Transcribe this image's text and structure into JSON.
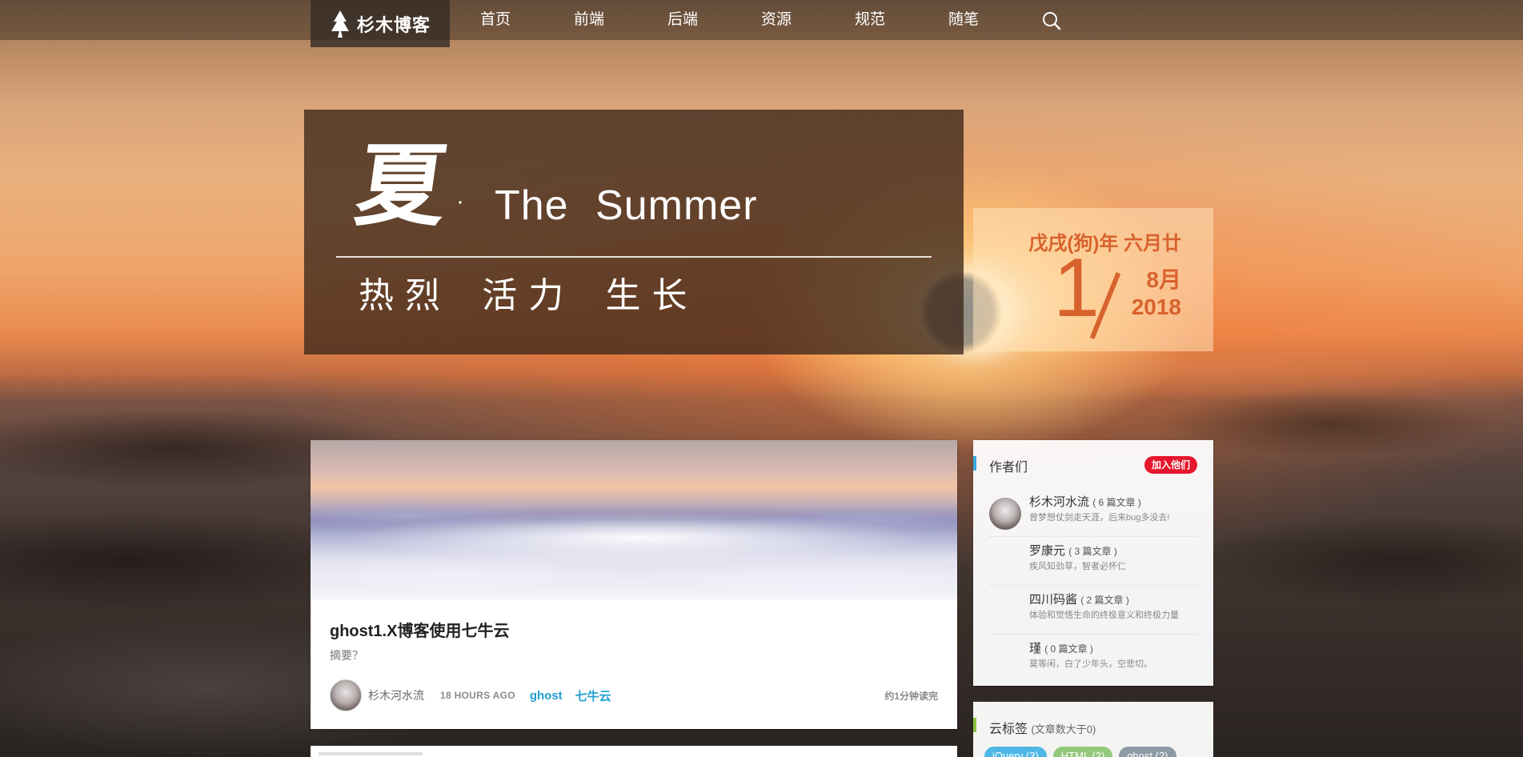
{
  "brand": {
    "name": "杉木博客"
  },
  "nav": {
    "items": [
      "首页",
      "前端",
      "后端",
      "资源",
      "规范",
      "随笔"
    ]
  },
  "hero": {
    "char": "夏",
    "dot": "·",
    "title": "The Summer",
    "subtitle": "热烈 活力 生长"
  },
  "date": {
    "lunar": "戊戌(狗)年 六月廿",
    "day": "1",
    "month": "8月",
    "year": "2018"
  },
  "post": {
    "title": "ghost1.X博客使用七牛云",
    "excerpt": "摘要？",
    "author": "杉木河水流",
    "time": "18 HOURS AGO",
    "tags": [
      "ghost",
      "七牛云"
    ],
    "read_time": "约1分钟读完"
  },
  "authors_widget": {
    "title": "作者们",
    "join_label": "加入他们",
    "authors": [
      {
        "name": "杉木河水流",
        "count": "( 6 篇文章 )",
        "bio": "曾梦想仗剑走天涯，后来bug多没去!"
      },
      {
        "name": "罗康元",
        "count": "( 3 篇文章 )",
        "bio": "疾风知劲草，智者必怀仁"
      },
      {
        "name": "四川码酱",
        "count": "( 2 篇文章 )",
        "bio": "体验和觉悟生命的终极意义和终极力量"
      },
      {
        "name": "瑾",
        "count": "( 0 篇文章 )",
        "bio": "莫等闲，白了少年头，空悲切。"
      }
    ]
  },
  "tags_widget": {
    "title": "云标签",
    "note": "(文章数大于0)",
    "tags": [
      {
        "label": "jQuery (3)",
        "color": "#4fb7e6"
      },
      {
        "label": "HTML (2)",
        "color": "#93c97c"
      },
      {
        "label": "ghost (2)",
        "color": "#8b9aa6"
      }
    ]
  },
  "colors": {
    "accent": "#d8622d",
    "link": "#1e9fd1",
    "join": "#e6162d"
  }
}
